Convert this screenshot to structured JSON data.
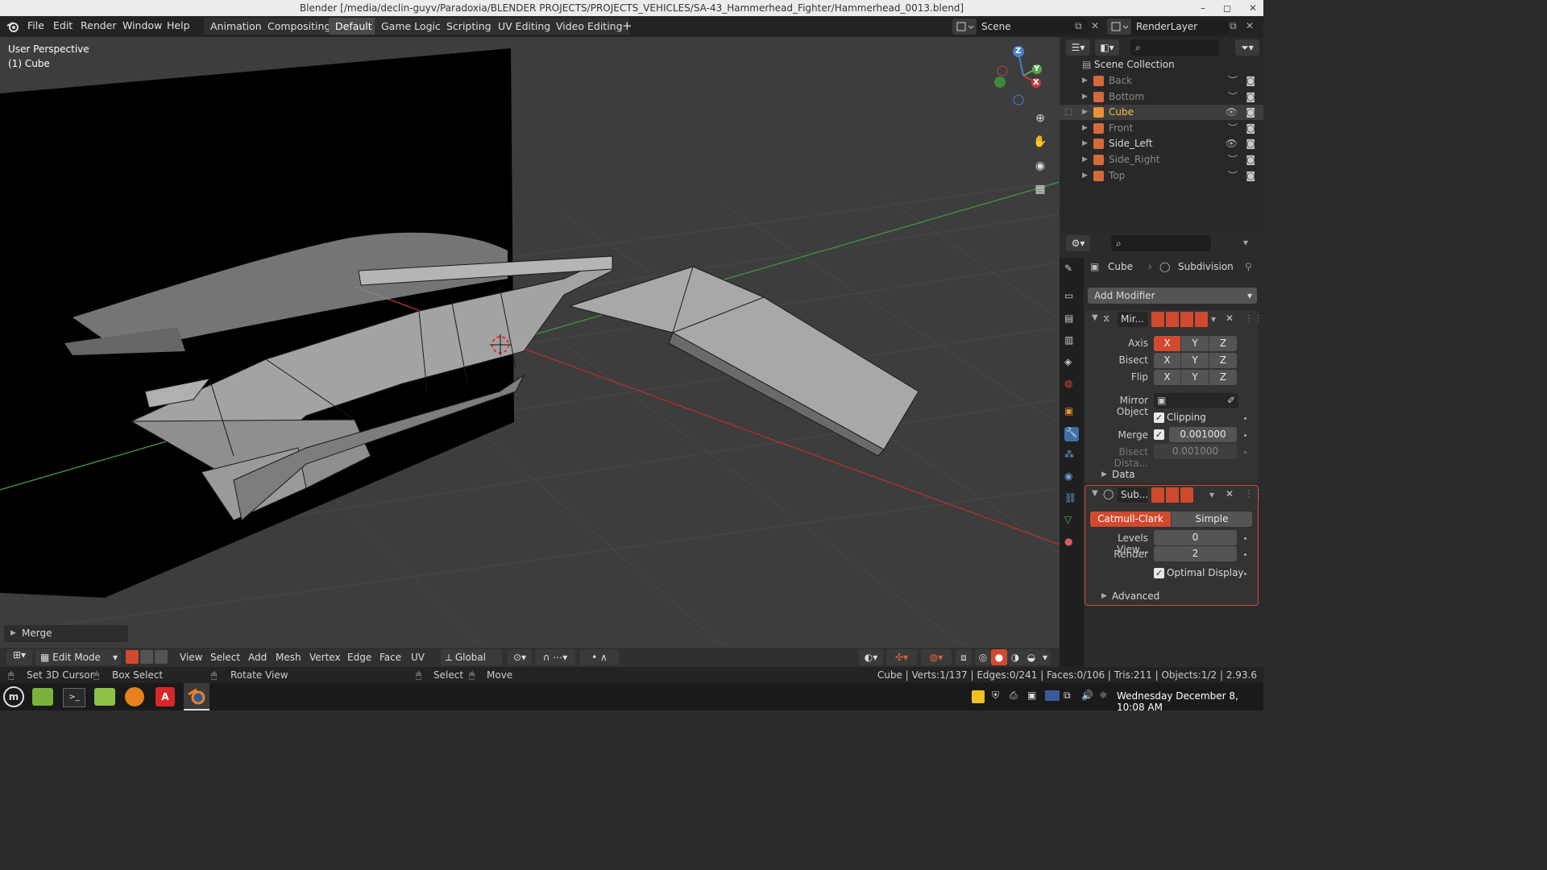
{
  "window": {
    "title": "Blender [/media/declin-guyv/Paradoxia/BLENDER PROJECTS/PROJECTS_VEHICLES/SA-43_Hammerhead_Fighter/Hammerhead_0013.blend]",
    "minimize": "–",
    "maximize": "◻",
    "close": "✕"
  },
  "menu": [
    "File",
    "Edit",
    "Render",
    "Window",
    "Help"
  ],
  "workspaces": [
    "Animation",
    "Compositing",
    "Default",
    "Game Logic",
    "Scripting",
    "UV Editing",
    "Video Editing"
  ],
  "workspace_add": "+",
  "scene": {
    "label": "Scene",
    "render_layer": "RenderLayer"
  },
  "viewport": {
    "perspective": "User Perspective",
    "object": "(1) Cube",
    "gizmo": {
      "z": "Z",
      "y": "Y",
      "x": "X"
    }
  },
  "last_op_panel": {
    "label": "Merge"
  },
  "viewport_header": {
    "mode": "Edit Mode",
    "menus": [
      "View",
      "Select",
      "Add",
      "Mesh",
      "Vertex",
      "Edge",
      "Face",
      "UV"
    ],
    "orientation": "Global"
  },
  "outliner": {
    "root": "Scene Collection",
    "items": [
      {
        "name": "Back",
        "selected": false,
        "visible": false,
        "color": "#8a8a8a"
      },
      {
        "name": "Bottom",
        "selected": false,
        "visible": false,
        "color": "#8a8a8a"
      },
      {
        "name": "Cube",
        "selected": true,
        "visible": true,
        "color": "#f0c040"
      },
      {
        "name": "Front",
        "selected": false,
        "visible": false,
        "color": "#8a8a8a"
      },
      {
        "name": "Side_Left",
        "selected": false,
        "visible": true,
        "color": "#d8d8d8"
      },
      {
        "name": "Side_Right",
        "selected": false,
        "visible": false,
        "color": "#8a8a8a"
      },
      {
        "name": "Top",
        "selected": false,
        "visible": false,
        "color": "#8a8a8a"
      }
    ]
  },
  "properties": {
    "object": "Cube",
    "modifier": "Subdivision",
    "add_modifier": "Add Modifier",
    "mirror": {
      "name": "Mir...",
      "axis_label": "Axis",
      "bisect_label": "Bisect",
      "flip_label": "Flip",
      "xyz": [
        "X",
        "Y",
        "Z"
      ],
      "mirror_object_label": "Mirror Object",
      "clipping_label": "Clipping",
      "merge_label": "Merge",
      "merge_value": "0.001000",
      "bisect_distance_label": "Bisect Dista...",
      "bisect_distance_value": "0.001000",
      "data_label": "Data"
    },
    "subsurf": {
      "name": "Sub...",
      "catmull": "Catmull-Clark",
      "simple": "Simple",
      "levels_label": "Levels View...",
      "levels_value": "0",
      "render_label": "Render",
      "render_value": "2",
      "optimal_label": "Optimal Display",
      "advanced_label": "Advanced"
    }
  },
  "statusbar": {
    "set_cursor": "Set 3D Cursor",
    "box_select": "Box Select",
    "rotate_view": "Rotate View",
    "select": "Select",
    "move": "Move",
    "stats": "Cube | Verts:1/137 | Edges:0/241 | Faces:0/106 | Tris:211 | Objects:1/2 | 2.93.6"
  },
  "taskbar": {
    "clock": "Wednesday December  8, 10:08 AM"
  },
  "colors": {
    "accent": "#d14a2f",
    "active_tab": "#4a4a4a",
    "selected_object": "#f0c040"
  }
}
